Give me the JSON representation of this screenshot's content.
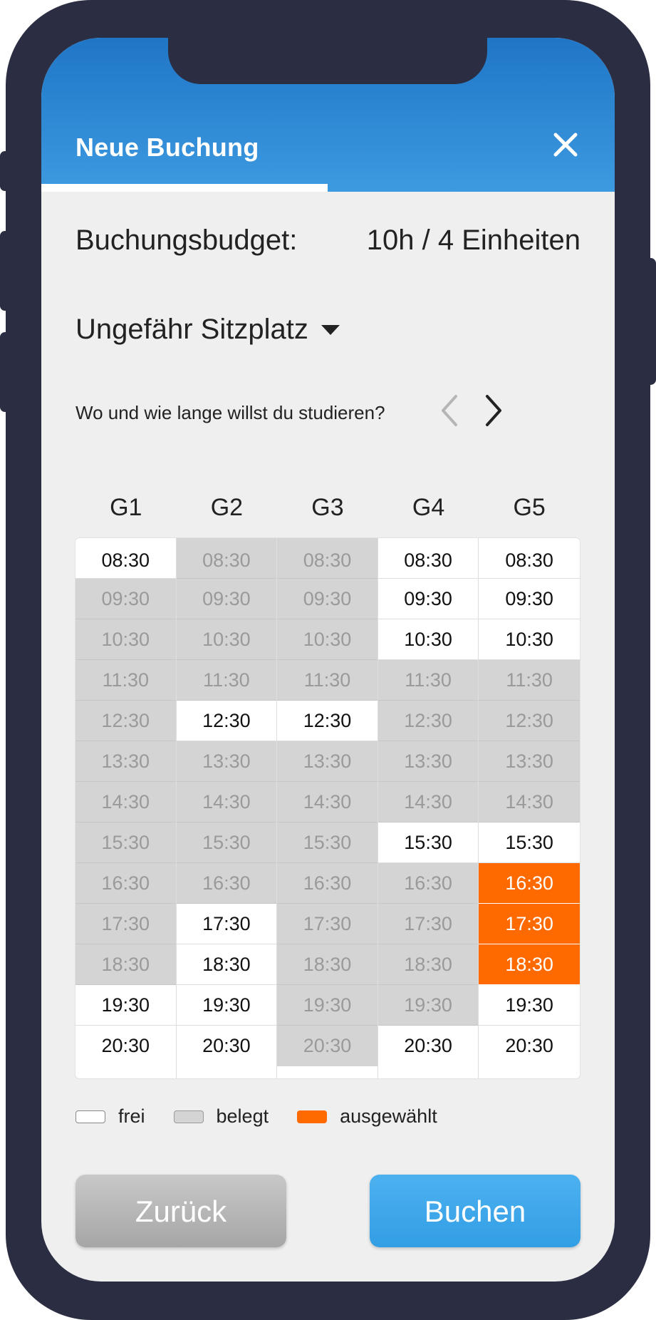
{
  "header": {
    "title": "Neue Buchung",
    "close_icon": "close-icon",
    "accent_color": "#2a88d6",
    "progress_fraction": 0.5
  },
  "budget": {
    "label": "Buchungsbudget:",
    "value": "10h / 4 Einheiten"
  },
  "seat_select": {
    "label": "Ungefähr Sitzplatz",
    "icon": "caret-down-icon"
  },
  "question": "Wo und wie lange willst du studieren?",
  "nav": {
    "prev_icon": "chevron-left-icon",
    "next_icon": "chevron-right-icon"
  },
  "schedule": {
    "columns": [
      {
        "name": "G1",
        "slots": [
          {
            "time": "08:30",
            "status": "free"
          },
          {
            "time": "09:30",
            "status": "busy"
          },
          {
            "time": "10:30",
            "status": "busy"
          },
          {
            "time": "11:30",
            "status": "busy"
          },
          {
            "time": "12:30",
            "status": "busy"
          },
          {
            "time": "13:30",
            "status": "busy"
          },
          {
            "time": "14:30",
            "status": "busy"
          },
          {
            "time": "15:30",
            "status": "busy"
          },
          {
            "time": "16:30",
            "status": "busy"
          },
          {
            "time": "17:30",
            "status": "busy"
          },
          {
            "time": "18:30",
            "status": "busy"
          },
          {
            "time": "19:30",
            "status": "free"
          },
          {
            "time": "20:30",
            "status": "free"
          }
        ]
      },
      {
        "name": "G2",
        "slots": [
          {
            "time": "08:30",
            "status": "busy"
          },
          {
            "time": "09:30",
            "status": "busy"
          },
          {
            "time": "10:30",
            "status": "busy"
          },
          {
            "time": "11:30",
            "status": "busy"
          },
          {
            "time": "12:30",
            "status": "free"
          },
          {
            "time": "13:30",
            "status": "busy"
          },
          {
            "time": "14:30",
            "status": "busy"
          },
          {
            "time": "15:30",
            "status": "busy"
          },
          {
            "time": "16:30",
            "status": "busy"
          },
          {
            "time": "17:30",
            "status": "free"
          },
          {
            "time": "18:30",
            "status": "free"
          },
          {
            "time": "19:30",
            "status": "free"
          },
          {
            "time": "20:30",
            "status": "free"
          }
        ]
      },
      {
        "name": "G3",
        "slots": [
          {
            "time": "08:30",
            "status": "busy"
          },
          {
            "time": "09:30",
            "status": "busy"
          },
          {
            "time": "10:30",
            "status": "busy"
          },
          {
            "time": "11:30",
            "status": "busy"
          },
          {
            "time": "12:30",
            "status": "free"
          },
          {
            "time": "13:30",
            "status": "busy"
          },
          {
            "time": "14:30",
            "status": "busy"
          },
          {
            "time": "15:30",
            "status": "busy"
          },
          {
            "time": "16:30",
            "status": "busy"
          },
          {
            "time": "17:30",
            "status": "busy"
          },
          {
            "time": "18:30",
            "status": "busy"
          },
          {
            "time": "19:30",
            "status": "busy"
          },
          {
            "time": "20:30",
            "status": "busy"
          }
        ]
      },
      {
        "name": "G4",
        "slots": [
          {
            "time": "08:30",
            "status": "free"
          },
          {
            "time": "09:30",
            "status": "free"
          },
          {
            "time": "10:30",
            "status": "free"
          },
          {
            "time": "11:30",
            "status": "busy"
          },
          {
            "time": "12:30",
            "status": "busy"
          },
          {
            "time": "13:30",
            "status": "busy"
          },
          {
            "time": "14:30",
            "status": "busy"
          },
          {
            "time": "15:30",
            "status": "free"
          },
          {
            "time": "16:30",
            "status": "busy"
          },
          {
            "time": "17:30",
            "status": "busy"
          },
          {
            "time": "18:30",
            "status": "busy"
          },
          {
            "time": "19:30",
            "status": "busy"
          },
          {
            "time": "20:30",
            "status": "free"
          }
        ]
      },
      {
        "name": "G5",
        "slots": [
          {
            "time": "08:30",
            "status": "free"
          },
          {
            "time": "09:30",
            "status": "free"
          },
          {
            "time": "10:30",
            "status": "free"
          },
          {
            "time": "11:30",
            "status": "busy"
          },
          {
            "time": "12:30",
            "status": "busy"
          },
          {
            "time": "13:30",
            "status": "busy"
          },
          {
            "time": "14:30",
            "status": "busy"
          },
          {
            "time": "15:30",
            "status": "free"
          },
          {
            "time": "16:30",
            "status": "selected"
          },
          {
            "time": "17:30",
            "status": "selected"
          },
          {
            "time": "18:30",
            "status": "selected"
          },
          {
            "time": "19:30",
            "status": "free"
          },
          {
            "time": "20:30",
            "status": "free"
          }
        ]
      }
    ]
  },
  "legend": {
    "free": "frei",
    "busy": "belegt",
    "selected": "ausgewählt"
  },
  "colors": {
    "free": "#ffffff",
    "busy": "#d4d4d4",
    "selected": "#ff6a00"
  },
  "buttons": {
    "back": "Zurück",
    "book": "Buchen"
  }
}
